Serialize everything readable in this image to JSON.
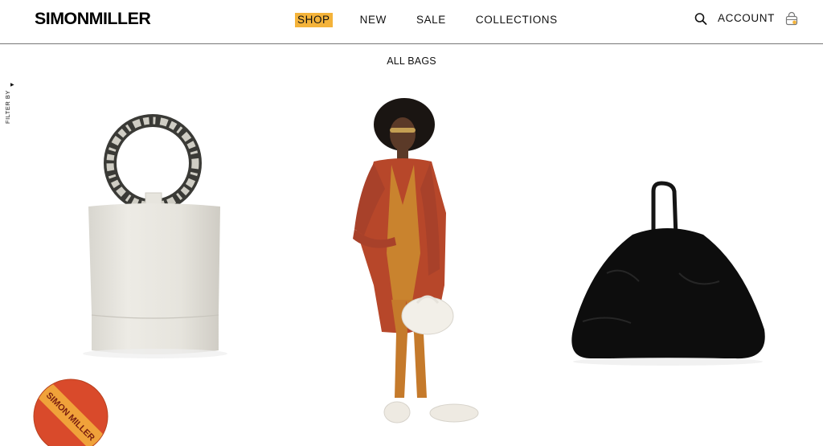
{
  "brand": {
    "logo_text": "SIMONMILLER"
  },
  "nav": {
    "items": [
      {
        "label": "SHOP",
        "active": true
      },
      {
        "label": "NEW",
        "active": false
      },
      {
        "label": "SALE",
        "active": false
      },
      {
        "label": "COLLECTIONS",
        "active": false
      }
    ],
    "account_label": "ACCOUNT",
    "active_color": "#f4b33a"
  },
  "icons": {
    "search": "search-icon",
    "cart": "shopping-bag-icon",
    "filter_arrow": "caret-right-icon"
  },
  "category": {
    "title": "ALL BAGS"
  },
  "filter": {
    "label": "FILTER BY"
  },
  "products": [
    {
      "name": "white-bucket-bag-with-tortoise-ring-handle"
    },
    {
      "name": "model-in-rust-cardigan-holding-white-pouch"
    },
    {
      "name": "black-shearling-tote-bag"
    }
  ],
  "sticker": {
    "text": "SIMON MILLER",
    "colors": [
      "#f0a23a",
      "#d94a2b"
    ]
  }
}
